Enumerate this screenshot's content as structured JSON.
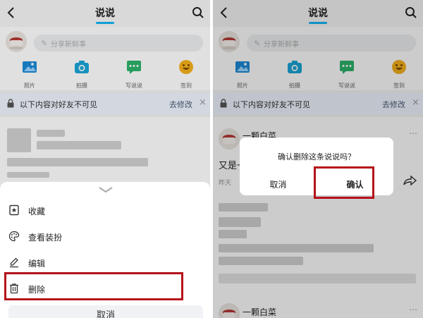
{
  "left": {
    "header": {
      "title": "说说"
    },
    "compose": {
      "placeholder": "分享新鲜事"
    },
    "actions": [
      {
        "label": "照片",
        "icon": "photo-icon"
      },
      {
        "label": "拍摄",
        "icon": "camera-icon"
      },
      {
        "label": "写说说",
        "icon": "chat-icon"
      },
      {
        "label": "签到",
        "icon": "smiley-icon"
      }
    ],
    "banner": {
      "text": "以下内容对好友不可见",
      "action": "去修改"
    },
    "sheet": {
      "items": [
        {
          "label": "收藏",
          "icon": "bookmark-icon"
        },
        {
          "label": "查看装扮",
          "icon": "palette-icon"
        },
        {
          "label": "编辑",
          "icon": "edit-icon"
        },
        {
          "label": "删除",
          "icon": "trash-icon"
        }
      ],
      "cancel_label": "取消"
    }
  },
  "right": {
    "header": {
      "title": "说说"
    },
    "compose": {
      "placeholder": "分享新鲜事"
    },
    "actions": [
      {
        "label": "照片",
        "icon": "photo-icon"
      },
      {
        "label": "拍摄",
        "icon": "camera-icon"
      },
      {
        "label": "写说说",
        "icon": "chat-icon"
      },
      {
        "label": "签到",
        "icon": "smiley-icon"
      }
    ],
    "banner": {
      "text": "以下内容对好友不可见",
      "action": "去修改"
    },
    "feed": {
      "post1": {
        "name": "一颗白菜",
        "text_prefix": "又是一",
        "time_prefix": "昨天"
      },
      "post2": {
        "name": "一颗白菜"
      }
    },
    "dialog": {
      "message": "确认删除这条说说吗？",
      "cancel_label": "取消",
      "confirm_label": "确认"
    }
  },
  "colors": {
    "accent": "#12b7f5",
    "highlight": "#b5121b",
    "banner_bg": "#f0f5ff"
  }
}
